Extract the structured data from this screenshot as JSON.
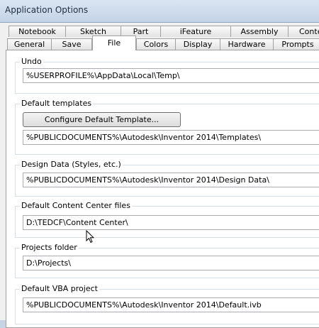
{
  "window": {
    "title": "Application Options"
  },
  "tabs_back": [
    "Notebook",
    "Sketch",
    "Part",
    "iFeature",
    "Assembly",
    "Conte"
  ],
  "tabs_front": [
    "General",
    "Save",
    "File",
    "Colors",
    "Display",
    "Hardware",
    "Prompts"
  ],
  "active_tab": "File",
  "groups": {
    "undo": {
      "label": "Undo",
      "path": "%USERPROFILE%\\AppData\\Local\\Temp\\"
    },
    "templates": {
      "label": "Default templates",
      "button_label": "Configure Default Template...",
      "path": "%PUBLICDOCUMENTS%\\Autodesk\\Inventor 2014\\Templates\\"
    },
    "design_data": {
      "label": "Design Data (Styles, etc.)",
      "path": "%PUBLICDOCUMENTS%\\Autodesk\\Inventor 2014\\Design Data\\"
    },
    "content_center": {
      "label": "Default Content Center files",
      "path": "D:\\TEDCF\\Content Center\\"
    },
    "projects": {
      "label": "Projects folder",
      "path": "D:\\Projects\\"
    },
    "vba": {
      "label": "Default VBA project",
      "path": "%PUBLICDOCUMENTS%\\Autodesk\\Inventor 2014\\Default.ivb"
    }
  }
}
